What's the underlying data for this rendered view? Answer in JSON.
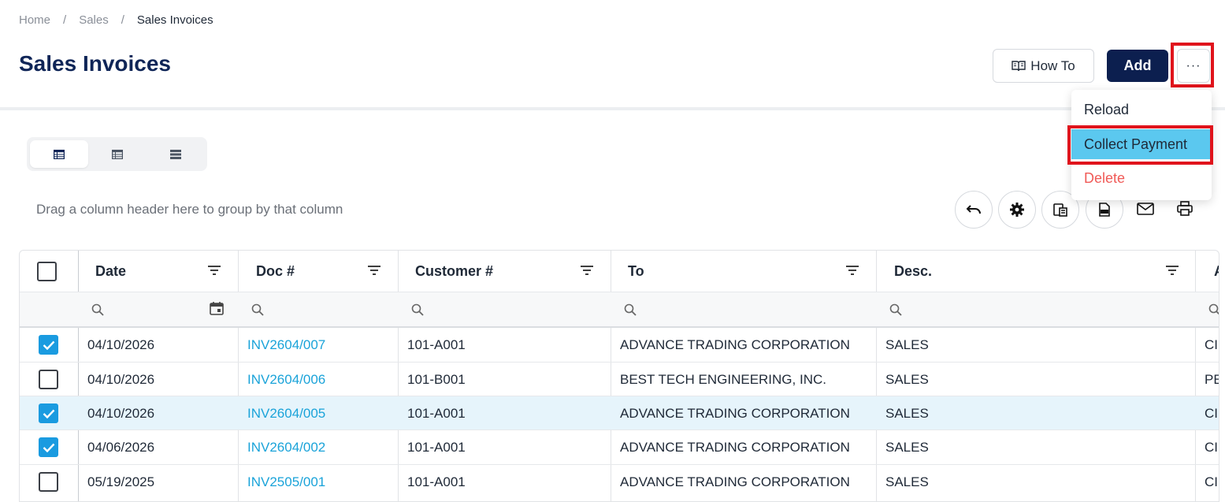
{
  "breadcrumb": {
    "home": "Home",
    "sales": "Sales",
    "current": "Sales Invoices",
    "sep": "/"
  },
  "page": {
    "title": "Sales Invoices"
  },
  "header_actions": {
    "how_to": "How To",
    "add": "Add",
    "more": "···"
  },
  "menu": {
    "reload": "Reload",
    "collect_payment": "Collect Payment",
    "delete": "Delete"
  },
  "toolbar": {
    "group_hint": "Drag a column header here to group by that column"
  },
  "grid": {
    "columns": {
      "date": "Date",
      "doc": "Doc #",
      "customer": "Customer #",
      "to": "To",
      "desc": "Desc.",
      "next": "A"
    },
    "rows": [
      {
        "checked": true,
        "date": "04/10/2026",
        "doc": "INV2604/007",
        "customer": "101-A001",
        "to": "ADVANCE TRADING CORPORATION",
        "desc": "SALES",
        "next": "CI"
      },
      {
        "checked": false,
        "date": "04/10/2026",
        "doc": "INV2604/006",
        "customer": "101-B001",
        "to": "BEST TECH ENGINEERING, INC.",
        "desc": "SALES",
        "next": "PE"
      },
      {
        "checked": true,
        "date": "04/10/2026",
        "doc": "INV2604/005",
        "customer": "101-A001",
        "to": "ADVANCE TRADING CORPORATION",
        "desc": "SALES",
        "next": "CI"
      },
      {
        "checked": true,
        "date": "04/06/2026",
        "doc": "INV2604/002",
        "customer": "101-A001",
        "to": "ADVANCE TRADING CORPORATION",
        "desc": "SALES",
        "next": "CI"
      },
      {
        "checked": false,
        "date": "05/19/2025",
        "doc": "INV2505/001",
        "customer": "101-A001",
        "to": "ADVANCE TRADING CORPORATION",
        "desc": "SALES",
        "next": "CI"
      }
    ]
  },
  "colors": {
    "title": "#0f2557",
    "add_button": "#0c1f4f",
    "link": "#1aa3d9",
    "menu_active": "#5bc8ef",
    "danger": "#f05a57",
    "checkbox": "#1a9be0",
    "highlight": "#e0141c"
  }
}
